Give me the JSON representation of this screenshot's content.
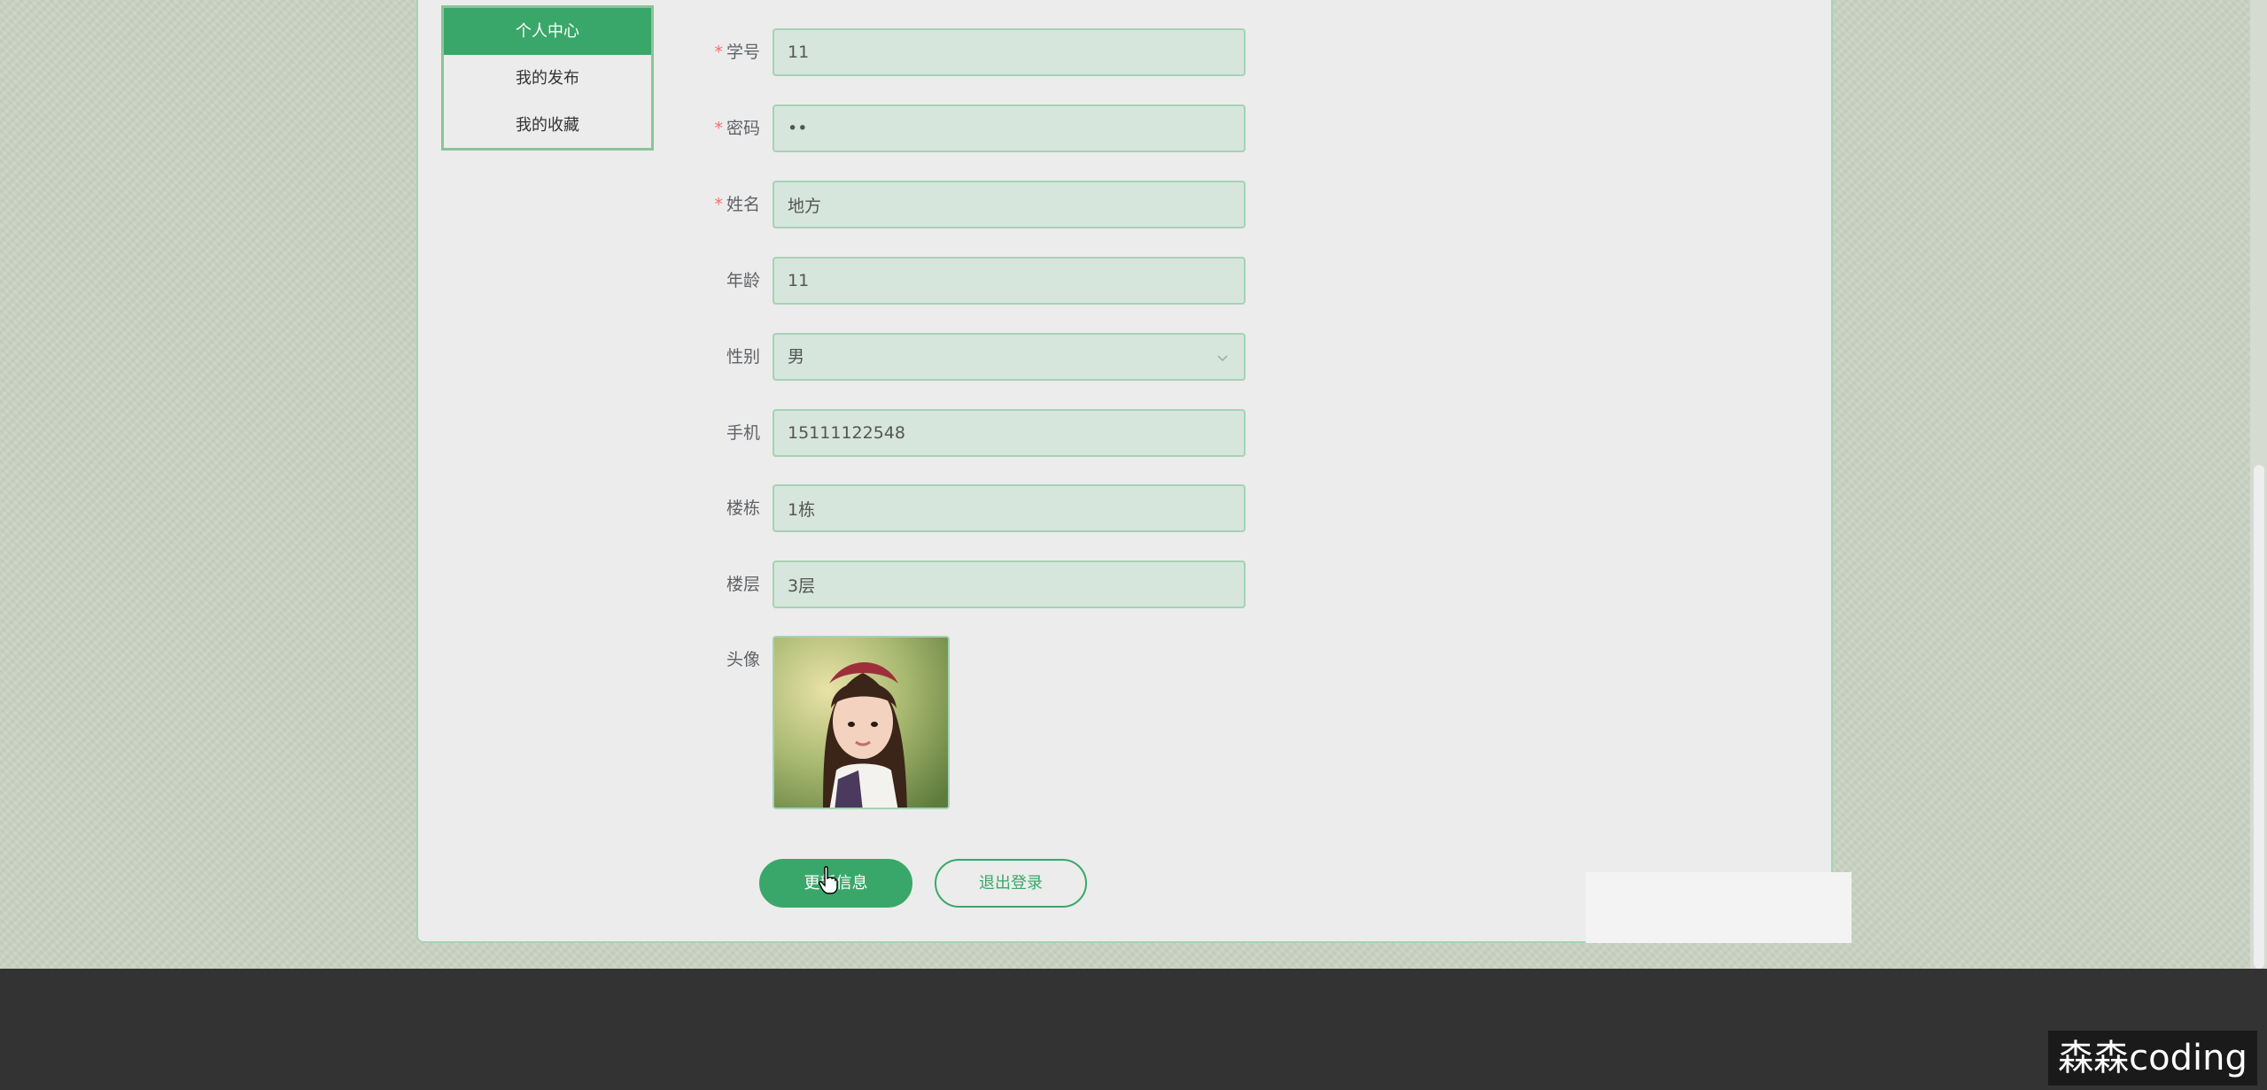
{
  "side_menu": {
    "items": [
      {
        "label": "个人中心",
        "active": true
      },
      {
        "label": "我的发布",
        "active": false
      },
      {
        "label": "我的收藏",
        "active": false
      }
    ]
  },
  "form": {
    "student_id": {
      "label": "学号",
      "required": true,
      "value": "11"
    },
    "password": {
      "label": "密码",
      "required": true,
      "value": "••"
    },
    "name": {
      "label": "姓名",
      "required": true,
      "value": "地方"
    },
    "age": {
      "label": "年龄",
      "required": false,
      "value": "11"
    },
    "gender": {
      "label": "性别",
      "required": false,
      "value": "男"
    },
    "phone": {
      "label": "手机",
      "required": false,
      "value": "15111122548"
    },
    "building": {
      "label": "楼栋",
      "required": false,
      "value": "1栋"
    },
    "floor": {
      "label": "楼层",
      "required": false,
      "value": "3层"
    },
    "avatar": {
      "label": "头像"
    }
  },
  "buttons": {
    "update": "更新信息",
    "logout": "退出登录"
  },
  "watermark": "森森coding",
  "colors": {
    "accent": "#3aa76a",
    "required": "#f56c6c",
    "footer": "#333333"
  }
}
